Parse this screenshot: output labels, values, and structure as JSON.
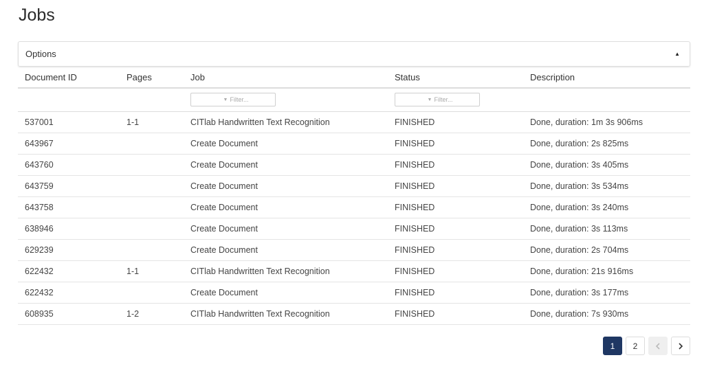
{
  "page": {
    "title": "Jobs"
  },
  "options": {
    "label": "Options",
    "toggle_icon": "caret-up-icon"
  },
  "table": {
    "headers": {
      "document_id": "Document ID",
      "pages": "Pages",
      "job": "Job",
      "status": "Status",
      "description": "Description"
    },
    "filters": {
      "job_placeholder": "Filter...",
      "status_placeholder": "Filter..."
    },
    "rows": [
      {
        "document_id": "537001",
        "pages": "1-1",
        "job": "CITlab Handwritten Text Recognition",
        "status": "FINISHED",
        "description": "Done, duration: 1m 3s 906ms"
      },
      {
        "document_id": "643967",
        "pages": "",
        "job": "Create Document",
        "status": "FINISHED",
        "description": "Done, duration: 2s 825ms"
      },
      {
        "document_id": "643760",
        "pages": "",
        "job": "Create Document",
        "status": "FINISHED",
        "description": "Done, duration: 3s 405ms"
      },
      {
        "document_id": "643759",
        "pages": "",
        "job": "Create Document",
        "status": "FINISHED",
        "description": "Done, duration: 3s 534ms"
      },
      {
        "document_id": "643758",
        "pages": "",
        "job": "Create Document",
        "status": "FINISHED",
        "description": "Done, duration: 3s 240ms"
      },
      {
        "document_id": "638946",
        "pages": "",
        "job": "Create Document",
        "status": "FINISHED",
        "description": "Done, duration: 3s 113ms"
      },
      {
        "document_id": "629239",
        "pages": "",
        "job": "Create Document",
        "status": "FINISHED",
        "description": "Done, duration: 2s 704ms"
      },
      {
        "document_id": "622432",
        "pages": "1-1",
        "job": "CITlab Handwritten Text Recognition",
        "status": "FINISHED",
        "description": "Done, duration: 21s 916ms"
      },
      {
        "document_id": "622432",
        "pages": "",
        "job": "Create Document",
        "status": "FINISHED",
        "description": "Done, duration: 3s 177ms"
      },
      {
        "document_id": "608935",
        "pages": "1-2",
        "job": "CITlab Handwritten Text Recognition",
        "status": "FINISHED",
        "description": "Done, duration: 7s 930ms"
      }
    ]
  },
  "pagination": {
    "pages": [
      "1",
      "2"
    ],
    "current": "1",
    "prev_icon": "chevron-left-icon",
    "next_icon": "chevron-right-icon",
    "active_color": "#1f3763"
  }
}
